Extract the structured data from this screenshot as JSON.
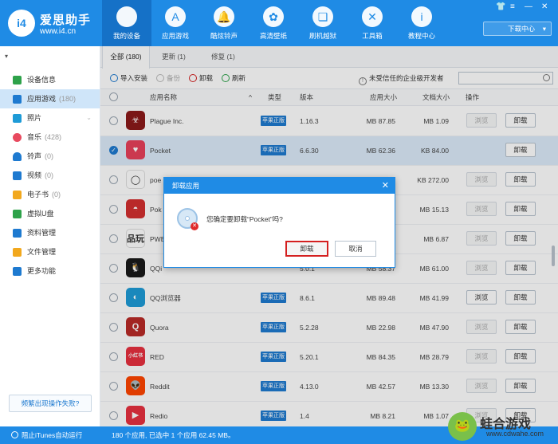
{
  "brand": {
    "logo": "i4",
    "name": "爱思助手",
    "url": "www.i4.cn"
  },
  "nav": [
    {
      "label": "我的设备",
      "icon": ""
    },
    {
      "label": "应用游戏",
      "icon": "A"
    },
    {
      "label": "酷炫铃声",
      "icon": "🔔"
    },
    {
      "label": "高清壁纸",
      "icon": "✿"
    },
    {
      "label": "刷机越狱",
      "icon": "❏"
    },
    {
      "label": "工具箱",
      "icon": "✕"
    },
    {
      "label": "教程中心",
      "icon": "i"
    }
  ],
  "window": {
    "shirt": "👕",
    "menu": "≡",
    "minimize": "—",
    "close": "✕"
  },
  "download_center": "下载中心",
  "sidebar": {
    "device_caret": "▾",
    "items": [
      {
        "label": "设备信息",
        "count": "",
        "color": "#2ea24a"
      },
      {
        "label": "应用游戏",
        "count": "(180)",
        "color": "#1e7ad0"
      },
      {
        "label": "照片",
        "count": "",
        "color": "#1e9bd7"
      },
      {
        "label": "音乐",
        "count": "(428)",
        "color": "#e84a5f"
      },
      {
        "label": "铃声",
        "count": "(0)",
        "color": "#1e7ad0"
      },
      {
        "label": "视频",
        "count": "(0)",
        "color": "#1e7ad0"
      },
      {
        "label": "电子书",
        "count": "(0)",
        "color": "#f2a81d"
      },
      {
        "label": "虚拟U盘",
        "count": "",
        "color": "#2ea24a"
      },
      {
        "label": "资料管理",
        "count": "",
        "color": "#1e7ad0"
      },
      {
        "label": "文件管理",
        "count": "",
        "color": "#f2a81d"
      },
      {
        "label": "更多功能",
        "count": "",
        "color": "#1e7ad0"
      }
    ],
    "freq_button": "频繁出现操作失败?"
  },
  "tabs": [
    {
      "label": "全部 (180)"
    },
    {
      "label": "更新 (1)"
    },
    {
      "label": "修复 (1)"
    }
  ],
  "toolbar": {
    "import": "导入安装",
    "backup": "备份",
    "uninstall": "卸载",
    "refresh": "刷新",
    "untrusted": "未受信任的企业级开发者",
    "search_placeholder": ""
  },
  "table": {
    "headers": {
      "name": "应用名称",
      "sort": "^",
      "type": "类型",
      "version": "版本",
      "app_size": "应用大小",
      "doc_size": "文档大小",
      "action": "操作"
    },
    "check": "✓",
    "rows": [
      {
        "name": "Plague Inc.",
        "type": "苹果正版",
        "version": "1.16.3",
        "app_size": "87.85 MB",
        "doc_size": "1.09 MB",
        "browse": "浏览",
        "uninstall": "卸载",
        "icon_bg": "#8b1a1a",
        "icon_text": "☣",
        "checked": false,
        "browse_enabled": false
      },
      {
        "name": "Pocket",
        "type": "苹果正版",
        "version": "6.6.30",
        "app_size": "62.36 MB",
        "doc_size": "84.00 KB",
        "browse": "",
        "uninstall": "卸载",
        "icon_bg": "#e8405a",
        "icon_text": "♥",
        "checked": true,
        "browse_enabled": false
      },
      {
        "name": "poe",
        "type": "",
        "version": "",
        "app_size": "",
        "doc_size": "272.00 KB",
        "browse": "浏览",
        "uninstall": "卸载",
        "icon_bg": "#ffffff",
        "icon_text": "◯",
        "checked": false,
        "browse_enabled": false
      },
      {
        "name": "Pok",
        "type": "",
        "version": "",
        "app_size": "",
        "doc_size": "15.13 MB",
        "browse": "浏览",
        "uninstall": "卸载",
        "icon_bg": "#d32f2f",
        "icon_text": "◓",
        "checked": false,
        "browse_enabled": false
      },
      {
        "name": "PWE",
        "type": "",
        "version": "",
        "app_size": "",
        "doc_size": "6.87 MB",
        "browse": "浏览",
        "uninstall": "卸载",
        "icon_bg": "#ffffff",
        "icon_text": "品玩",
        "checked": false,
        "browse_enabled": false
      },
      {
        "name": "QQi",
        "type": "",
        "version": "5.0.1",
        "app_size": "58.37 MB",
        "doc_size": "61.00 MB",
        "browse": "浏览",
        "uninstall": "卸载",
        "icon_bg": "#1a1a1a",
        "icon_text": "🐧",
        "checked": false,
        "browse_enabled": false
      },
      {
        "name": "QQ浏览器",
        "type": "苹果正版",
        "version": "8.6.1",
        "app_size": "89.48 MB",
        "doc_size": "41.99 MB",
        "browse": "浏览",
        "uninstall": "卸载",
        "icon_bg": "#1e9bd7",
        "icon_text": "◐",
        "checked": false,
        "browse_enabled": true
      },
      {
        "name": "Quora",
        "type": "苹果正版",
        "version": "5.2.28",
        "app_size": "22.98 MB",
        "doc_size": "47.90 MB",
        "browse": "浏览",
        "uninstall": "卸载",
        "icon_bg": "#b92b27",
        "icon_text": "Q",
        "checked": false,
        "browse_enabled": false
      },
      {
        "name": "RED",
        "type": "苹果正版",
        "version": "5.20.1",
        "app_size": "84.35 MB",
        "doc_size": "28.79 MB",
        "browse": "浏览",
        "uninstall": "卸载",
        "icon_bg": "#e8303f",
        "icon_text": "小红书",
        "checked": false,
        "browse_enabled": false
      },
      {
        "name": "Reddit",
        "type": "苹果正版",
        "version": "4.13.0",
        "app_size": "42.57 MB",
        "doc_size": "13.30 MB",
        "browse": "浏览",
        "uninstall": "卸载",
        "icon_bg": "#ff4500",
        "icon_text": "👽",
        "checked": false,
        "browse_enabled": false
      },
      {
        "name": "Redio",
        "type": "苹果正版",
        "version": "1.4",
        "app_size": "8.21 MB",
        "doc_size": "1.07 MB",
        "browse": "浏览",
        "uninstall": "卸载",
        "icon_bg": "#e8303f",
        "icon_text": "▶",
        "checked": false,
        "browse_enabled": false
      }
    ]
  },
  "status": {
    "itunes": "阻止iTunes自动运行",
    "text": "180 个应用, 已选中 1 个应用 62.45 MB。"
  },
  "modal": {
    "title": "卸载应用",
    "close": "✕",
    "message": "您确定要卸载“Pocket”吗?",
    "ok": "卸载",
    "cancel": "取消",
    "icon_x": "✕"
  },
  "watermark": {
    "logo": "🐸",
    "name": "蛙合游戏",
    "url": "www.cdwahe.com"
  }
}
